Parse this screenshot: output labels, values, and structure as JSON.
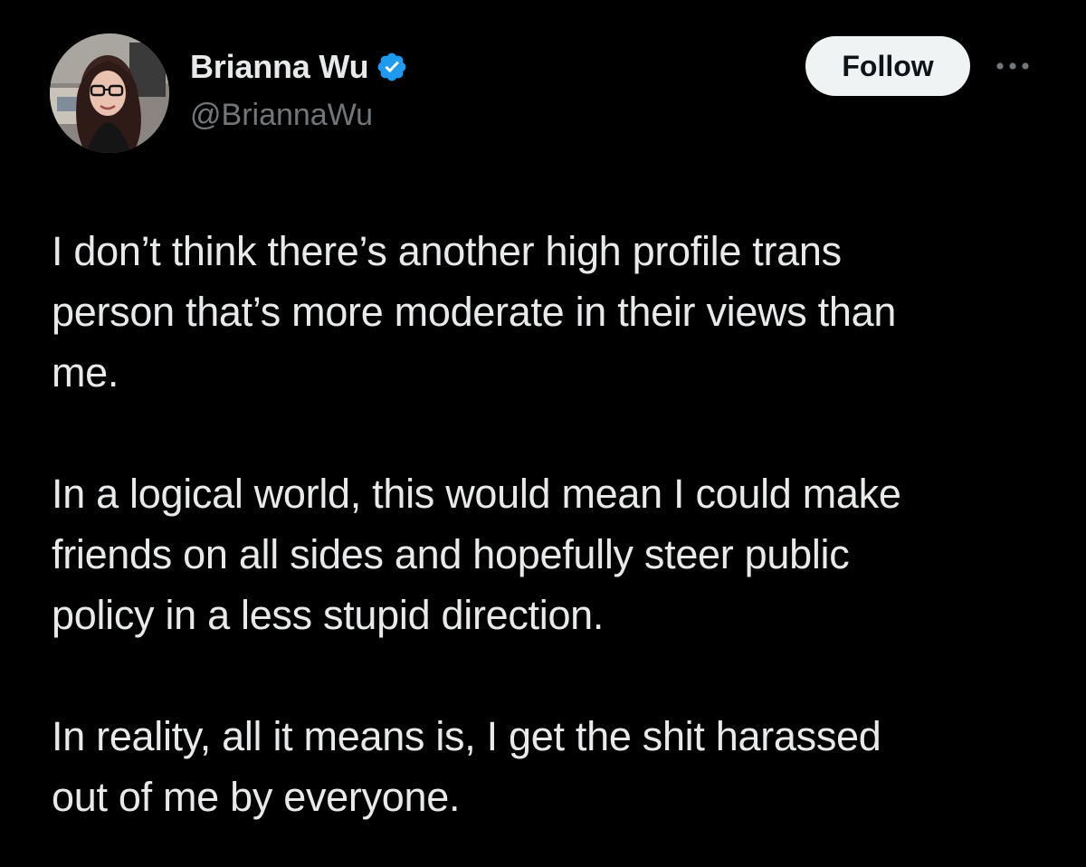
{
  "author": {
    "display_name": "Brianna Wu",
    "handle": "@BriannaWu",
    "verified": true,
    "verified_badge_color": "#1d9bf0"
  },
  "actions": {
    "follow_label": "Follow",
    "more_icon": "more-horizontal-icon"
  },
  "tweet": {
    "paragraphs": [
      "I don’t think there’s another high profile trans\nperson that’s more moderate in their views than\nme.",
      "In a logical world, this would mean I could make\nfriends on all sides and hopefully steer public\npolicy in a less stupid direction.",
      "In reality, all it means is, I get the shit harassed\nout of me by everyone."
    ]
  },
  "theme": {
    "background": "#000000",
    "text_primary": "#e7e9ea",
    "text_secondary": "#71767b",
    "follow_button_bg": "#eff3f4",
    "follow_button_text": "#0f1419"
  }
}
